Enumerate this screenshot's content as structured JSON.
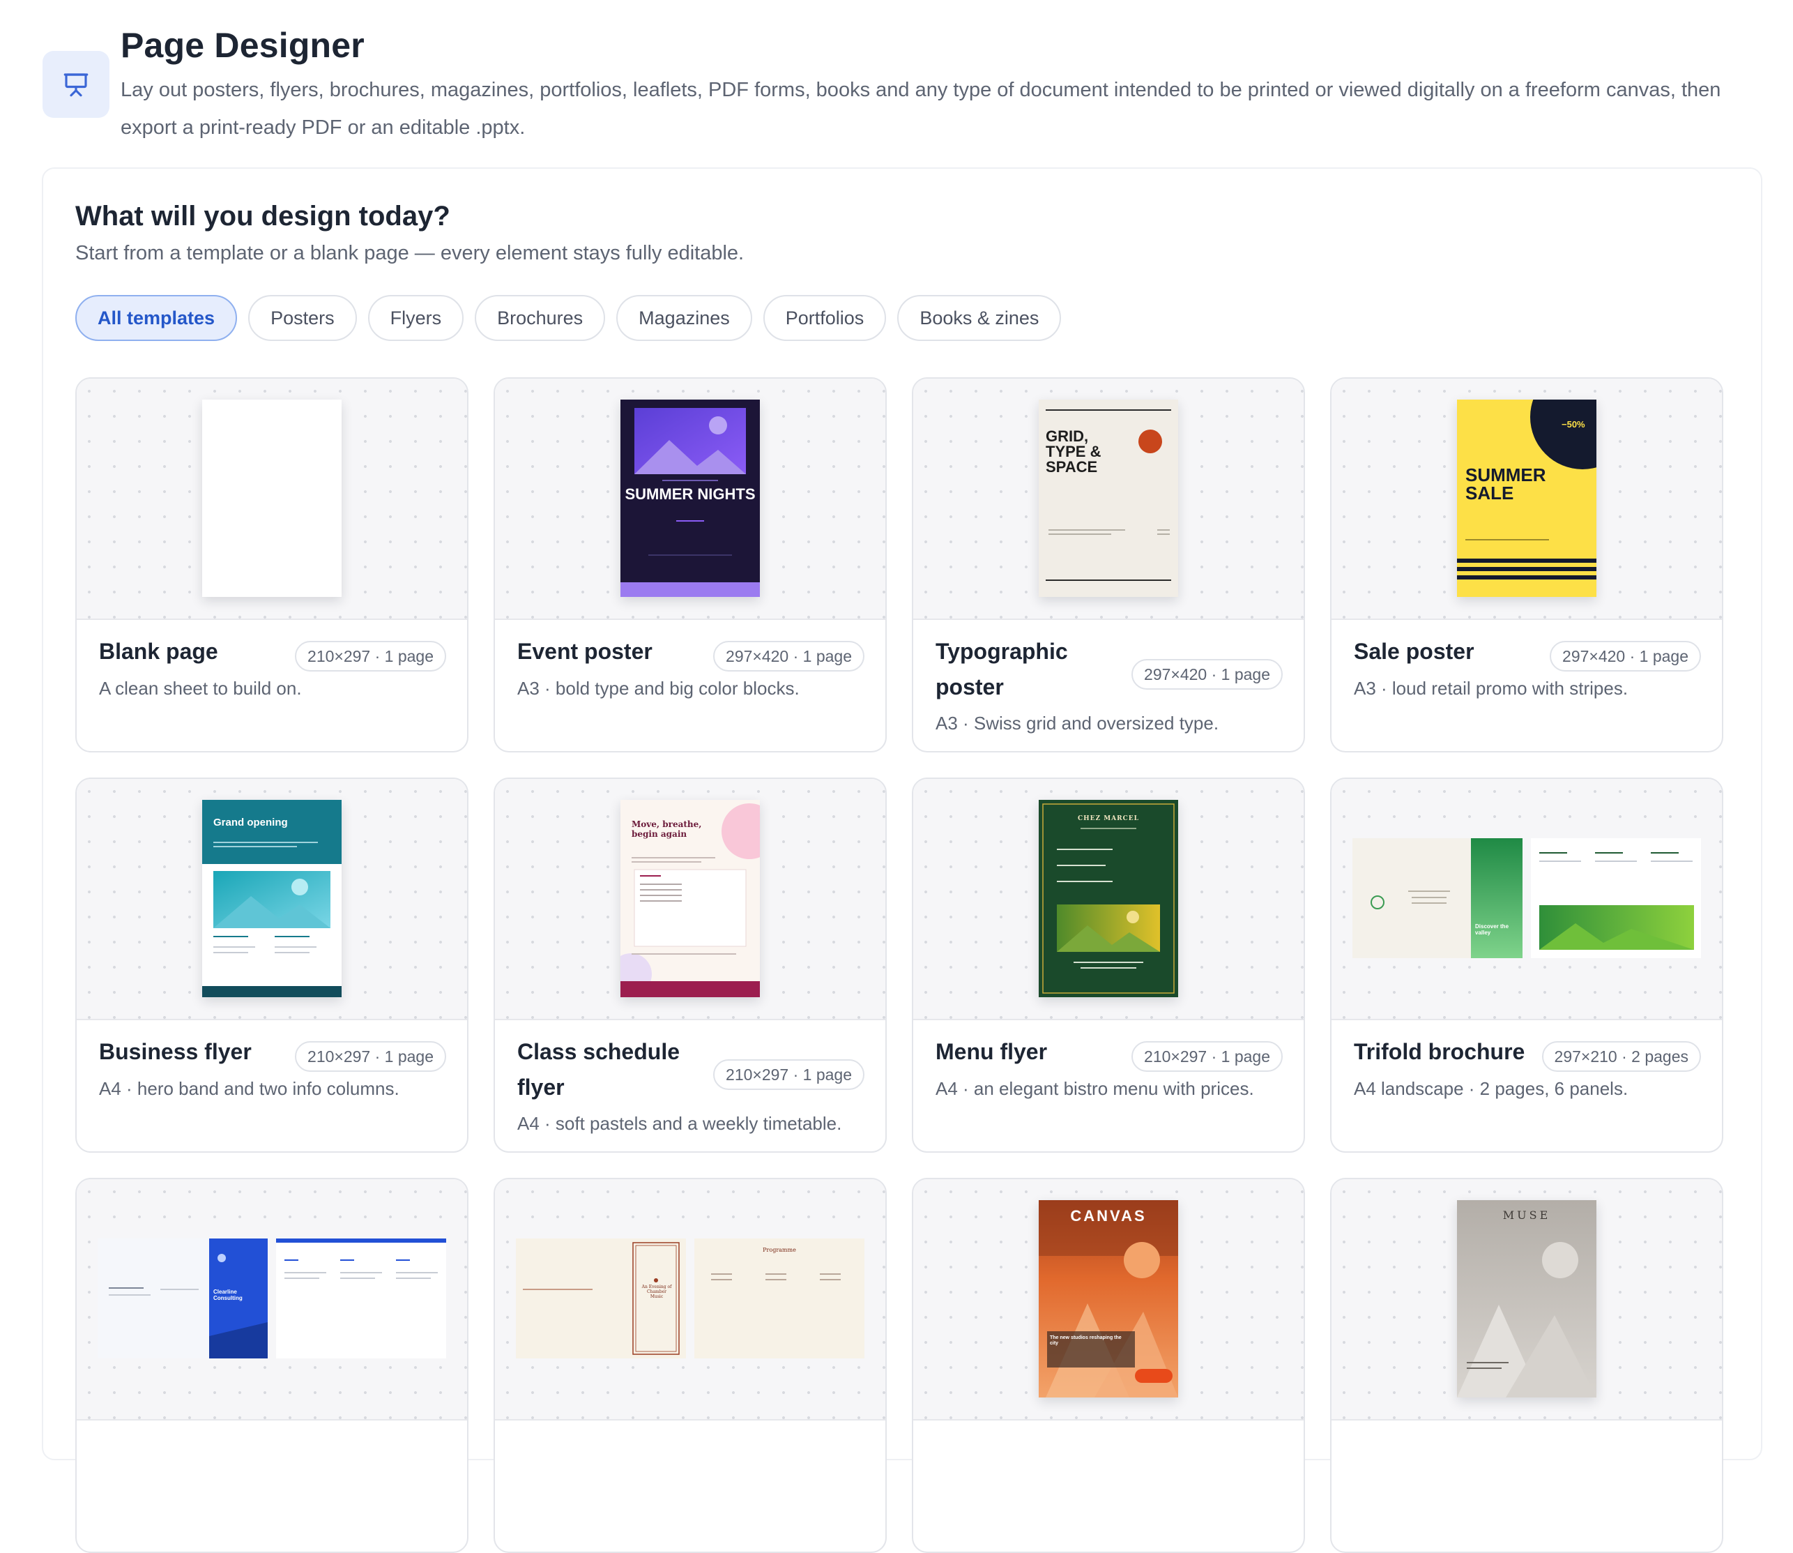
{
  "app": {
    "icon": "presentation-board-icon",
    "title": "Page Designer",
    "description": "Lay out posters, flyers, brochures, magazines, portfolios, leaflets, PDF forms, books and any type of document intended to be printed or viewed digitally on a freeform canvas, then export a print-ready PDF or an editable .pptx."
  },
  "panel": {
    "title": "What will you design today?",
    "subtitle": "Start from a template or a blank page — every element stays fully editable."
  },
  "tabs": [
    {
      "label": "All templates",
      "active": true
    },
    {
      "label": "Posters",
      "active": false
    },
    {
      "label": "Flyers",
      "active": false
    },
    {
      "label": "Brochures",
      "active": false
    },
    {
      "label": "Magazines",
      "active": false
    },
    {
      "label": "Portfolios",
      "active": false
    },
    {
      "label": "Books & zines",
      "active": false
    }
  ],
  "templates": [
    {
      "title": "Blank page",
      "badge": "210×297 · 1 page",
      "description": "A clean sheet to build on."
    },
    {
      "title": "Event poster",
      "badge": "297×420 · 1 page",
      "description": "A3 · bold type and big color blocks.",
      "preview_text": "SUMMER NIGHTS"
    },
    {
      "title": "Typographic poster",
      "badge": "297×420 · 1 page",
      "description": "A3 · Swiss grid and oversized type.",
      "preview_text": "GRID, TYPE & SPACE"
    },
    {
      "title": "Sale poster",
      "badge": "297×420 · 1 page",
      "description": "A3 · loud retail promo with stripes.",
      "preview_text": "SUMMER SALE",
      "preview_discount": "−50%"
    },
    {
      "title": "Business flyer",
      "badge": "210×297 · 1 page",
      "description": "A4 · hero band and two info columns.",
      "preview_text": "Grand opening"
    },
    {
      "title": "Class schedule flyer",
      "badge": "210×297 · 1 page",
      "description": "A4 · soft pastels and a weekly timetable.",
      "preview_text": "Move, breathe, begin again"
    },
    {
      "title": "Menu flyer",
      "badge": "210×297 · 1 page",
      "description": "A4 · an elegant bistro menu with prices.",
      "preview_text": "CHEZ MARCEL"
    },
    {
      "title": "Trifold brochure",
      "badge": "297×210 · 2 pages",
      "description": "A4 landscape · 2 pages, 6 panels.",
      "preview_text": "Discover the valley"
    },
    {
      "preview_text": "Clearline Consulting"
    },
    {
      "preview_text": "An Evening of Chamber Music",
      "preview_text_2": "Programme"
    },
    {
      "preview_text": "CANVAS",
      "preview_text_2": "The new studios reshaping the city"
    },
    {
      "preview_text": "MUSE"
    }
  ],
  "colors": {
    "accent": "#2457c9",
    "event_poster_bg": "#1c1537",
    "sale_poster_yellow": "#fde047",
    "flyer_teal": "#157a8c",
    "menu_green": "#1a4a2b",
    "brochure_blue": "#2250d6",
    "canvas_orange": "#e1692d",
    "muse_gray": "#b8b3ad"
  }
}
